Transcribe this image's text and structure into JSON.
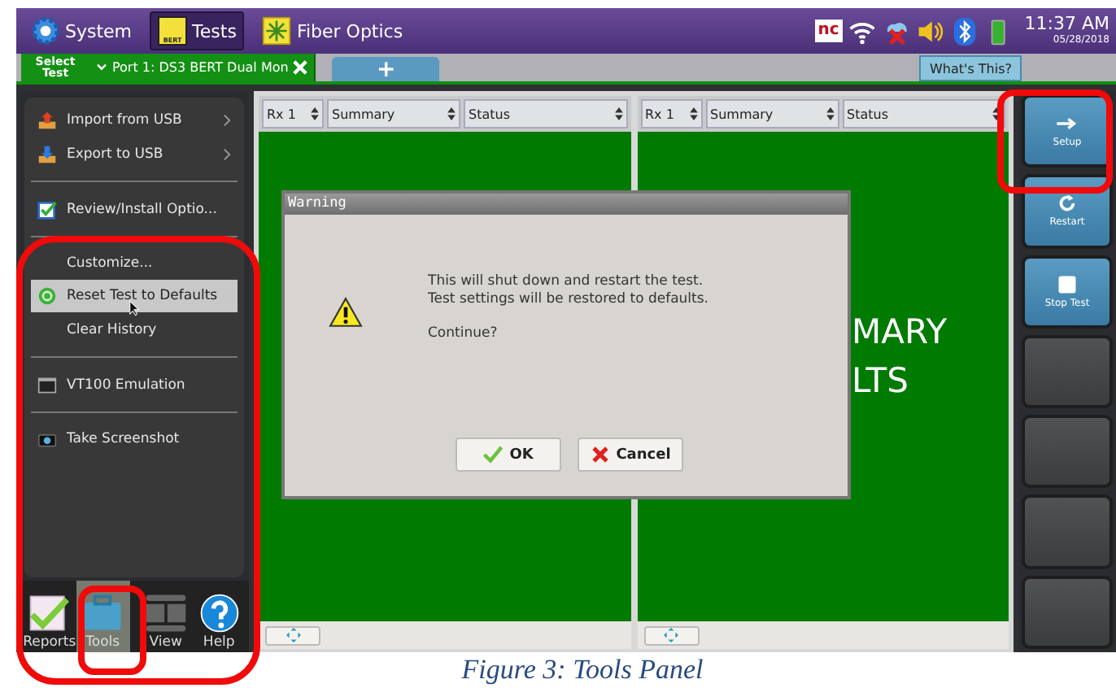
{
  "top_bar": {
    "apps": [
      {
        "label": "System",
        "kind": "gear",
        "selected": false
      },
      {
        "label": "Tests",
        "kind": "bert",
        "badge": "BERT",
        "selected": true
      },
      {
        "label": "Fiber Optics",
        "kind": "fiber",
        "selected": false
      }
    ],
    "logo_text": "nc",
    "time": "11:37 AM",
    "date": "05/28/2018"
  },
  "test_tabs": {
    "select_label": "Select Test",
    "tabs": [
      {
        "label": "Port 1: DS3 BERT Dual Mon",
        "kind": "port",
        "selected": true
      },
      {
        "label": "+",
        "kind": "add",
        "selected": false
      }
    ],
    "help_button": "What's This?"
  },
  "tools_menu": {
    "items": [
      {
        "label": "Import from USB",
        "kind": "import",
        "submenu": true,
        "selected": false,
        "divider_after": false
      },
      {
        "label": "Export to USB",
        "kind": "export",
        "submenu": true,
        "selected": false,
        "divider_after": true
      },
      {
        "label": "Review/Install Optio...",
        "kind": "check",
        "submenu": false,
        "selected": false,
        "divider_after": true
      },
      {
        "label": "Customize...",
        "kind": "plain",
        "submenu": false,
        "selected": false,
        "divider_after": false
      },
      {
        "label": "Reset Test to Defaults",
        "kind": "reset",
        "submenu": false,
        "selected": true,
        "divider_after": false
      },
      {
        "label": "Clear History",
        "kind": "plain",
        "submenu": false,
        "selected": false,
        "divider_after": true
      },
      {
        "label": "VT100 Emulation",
        "kind": "terminal",
        "submenu": false,
        "selected": false,
        "divider_after": true
      },
      {
        "label": "Take Screenshot",
        "kind": "camera",
        "submenu": false,
        "selected": false,
        "divider_after": false
      }
    ]
  },
  "bottom_tabs": [
    {
      "label": "Reports",
      "kind": "reports",
      "selected": false
    },
    {
      "label": "Tools",
      "kind": "tools",
      "selected": true
    },
    {
      "label": "View",
      "kind": "view",
      "selected": false
    },
    {
      "label": "Help",
      "kind": "help",
      "selected": false
    }
  ],
  "panes": [
    {
      "selectors": [
        "Rx 1",
        "Summary",
        "Status"
      ]
    },
    {
      "selectors": [
        "Rx 1",
        "Summary",
        "Status"
      ],
      "lines": [
        "MARY",
        "LTS"
      ]
    }
  ],
  "action_buttons": [
    {
      "label": "Setup",
      "kind": "setup"
    },
    {
      "label": "Restart",
      "kind": "restart"
    },
    {
      "label": "Stop Test",
      "kind": "stop"
    },
    {
      "kind": "empty"
    },
    {
      "kind": "empty"
    },
    {
      "kind": "empty"
    },
    {
      "kind": "empty"
    }
  ],
  "dialog": {
    "title": "Warning",
    "message": [
      "This will shut down and restart the test.",
      "Test settings will be restored to defaults."
    ],
    "prompt": "Continue?",
    "buttons": [
      {
        "label": "OK",
        "kind": "ok"
      },
      {
        "label": "Cancel",
        "kind": "cancel"
      }
    ]
  },
  "caption": "Figure 3: Tools Panel"
}
